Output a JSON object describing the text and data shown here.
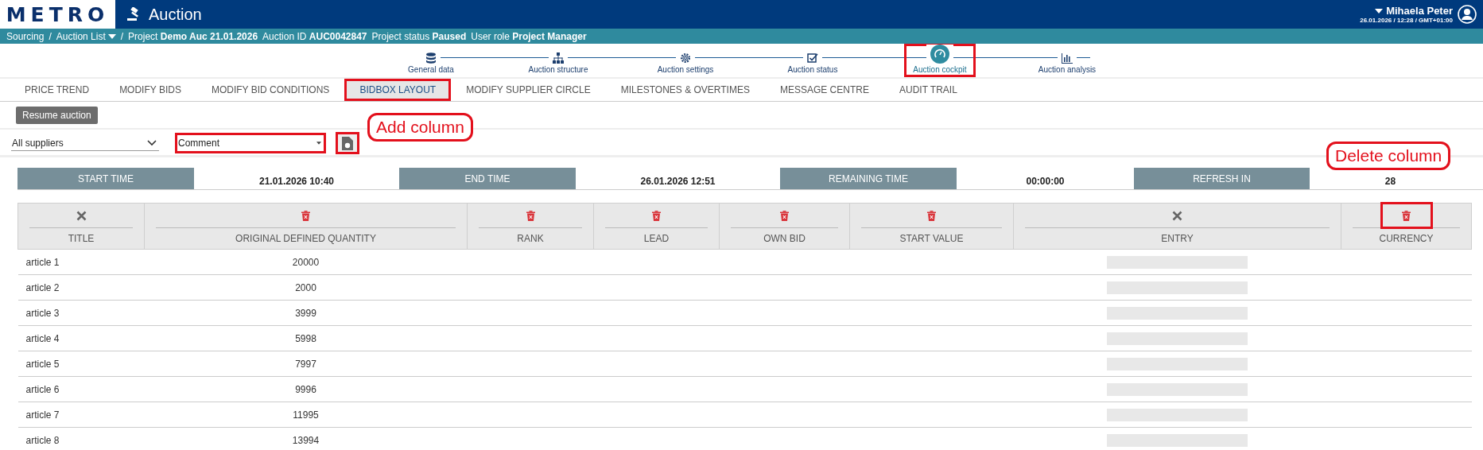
{
  "header": {
    "logo": "METRO",
    "app_title": "Auction",
    "user_name": "Mihaela Peter",
    "user_meta": "26.01.2026 / 12:28 / GMT+01:00"
  },
  "breadcrumb": {
    "separator": "/",
    "items": [
      {
        "label": "Sourcing",
        "kind": "link"
      },
      {
        "label": "Auction List",
        "kind": "dropdown"
      }
    ],
    "details": [
      "Project **Demo Auc 21.01.2026**",
      "Auction ID **AUC0042847**",
      "Project status **Paused**",
      "User role **Project Manager**"
    ]
  },
  "steps": [
    {
      "label": "General data",
      "kind": "database",
      "selected": false,
      "highlighted": false
    },
    {
      "label": "Auction structure",
      "kind": "hierarchy",
      "selected": false,
      "highlighted": false
    },
    {
      "label": "Auction settings",
      "kind": "gear",
      "selected": false,
      "highlighted": false
    },
    {
      "label": "Auction status",
      "kind": "checkbox",
      "selected": false,
      "highlighted": false
    },
    {
      "label": "Auction cockpit",
      "kind": "gauge",
      "selected": true,
      "highlighted": true
    },
    {
      "label": "Auction analysis",
      "kind": "chart",
      "selected": false,
      "highlighted": false
    }
  ],
  "tabs": [
    {
      "label": "PRICE TREND",
      "selected": false,
      "highlighted": false
    },
    {
      "label": "MODIFY BIDS",
      "selected": false,
      "highlighted": false
    },
    {
      "label": "MODIFY BID CONDITIONS",
      "selected": false,
      "highlighted": false
    },
    {
      "label": "BIDBOX LAYOUT",
      "selected": true,
      "highlighted": true
    },
    {
      "label": "MODIFY SUPPLIER CIRCLE",
      "selected": false,
      "highlighted": false
    },
    {
      "label": "MILESTONES & OVERTIMES",
      "selected": false,
      "highlighted": false
    },
    {
      "label": "MESSAGE CENTRE",
      "selected": false,
      "highlighted": false
    },
    {
      "label": "AUDIT TRAIL",
      "selected": false,
      "highlighted": false
    }
  ],
  "resume_button": "Resume auction",
  "filters": {
    "supplier": "All suppliers",
    "column": "Comment",
    "column_highlighted": true,
    "add_button_highlighted": true
  },
  "times": [
    {
      "label": "START TIME",
      "value": "21.01.2026 10:40"
    },
    {
      "label": "END TIME",
      "value": "26.01.2026 12:51"
    },
    {
      "label": "REMAINING TIME",
      "value": "00:00:00"
    },
    {
      "label": "REFRESH IN",
      "value": "28"
    }
  ],
  "table": {
    "columns": [
      {
        "title": "TITLE",
        "kind": "remove",
        "highlighted": false
      },
      {
        "title": "ORIGINAL DEFINED QUANTITY",
        "kind": "delete",
        "highlighted": false
      },
      {
        "title": "RANK",
        "kind": "delete",
        "highlighted": false
      },
      {
        "title": "LEAD",
        "kind": "delete",
        "highlighted": false
      },
      {
        "title": "OWN BID",
        "kind": "delete",
        "highlighted": false
      },
      {
        "title": "START VALUE",
        "kind": "delete",
        "highlighted": false
      },
      {
        "title": "ENTRY",
        "kind": "remove",
        "highlighted": false
      },
      {
        "title": "CURRENCY",
        "kind": "delete",
        "highlighted": true
      }
    ],
    "rows": [
      {
        "title": "article 1",
        "quantity": "20000"
      },
      {
        "title": "article 2",
        "quantity": "2000"
      },
      {
        "title": "article 3",
        "quantity": "3999"
      },
      {
        "title": "article 4",
        "quantity": "5998"
      },
      {
        "title": "article 5",
        "quantity": "7997"
      },
      {
        "title": "article 6",
        "quantity": "9996"
      },
      {
        "title": "article 7",
        "quantity": "11995"
      },
      {
        "title": "article 8",
        "quantity": "13994"
      }
    ]
  },
  "annotations": [
    {
      "text": "Add column"
    },
    {
      "text": "Delete column"
    }
  ]
}
